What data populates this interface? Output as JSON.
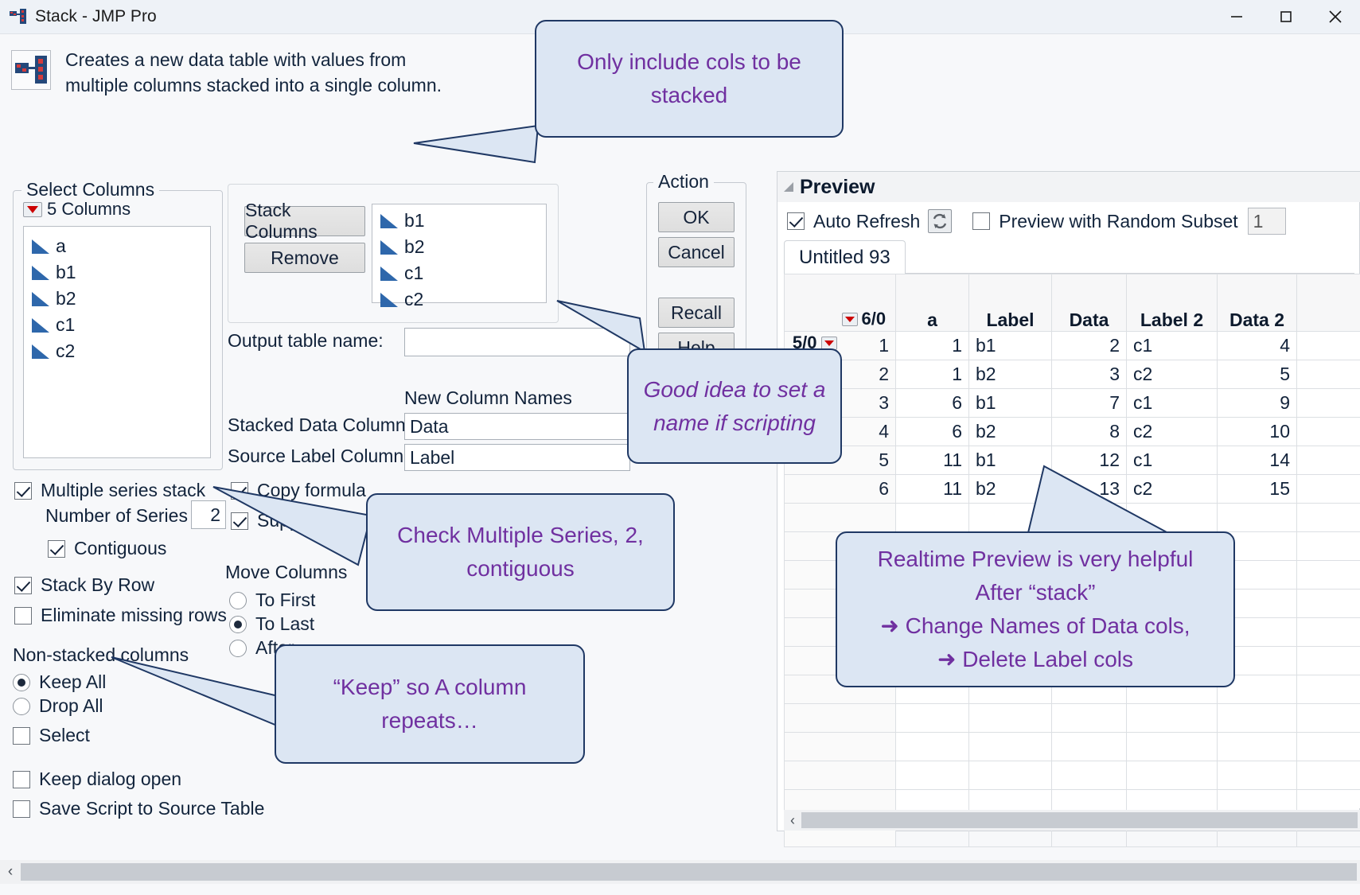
{
  "window": {
    "title": "Stack - JMP Pro",
    "minimize": "minimize-icon",
    "maximize": "maximize-icon",
    "close": "close-icon"
  },
  "description": "Creates a new data table with values from multiple columns stacked into a single column.",
  "select_columns": {
    "legend": "Select Columns",
    "count_label": "5 Columns",
    "items": [
      "a",
      "b1",
      "b2",
      "c1",
      "c2"
    ]
  },
  "stack_box": {
    "stack_button": "Stack Columns",
    "remove_button": "Remove",
    "items": [
      "b1",
      "b2",
      "c1",
      "c2"
    ]
  },
  "output_table": {
    "label": "Output table name:",
    "value": "",
    "placeholder": ""
  },
  "new_column_names": {
    "heading": "New Column Names",
    "stacked_data_label": "Stacked Data Column",
    "stacked_data_value": "Data",
    "source_label_label": "Source Label Column",
    "source_label_value": "Label"
  },
  "options": {
    "multiple_series_stack": {
      "label": "Multiple series stack",
      "checked": true
    },
    "number_of_series": {
      "label": "Number of Series",
      "value": "2"
    },
    "contiguous": {
      "label": "Contiguous",
      "checked": true
    },
    "stack_by_row": {
      "label": "Stack By Row",
      "checked": true
    },
    "eliminate_missing_rows": {
      "label": "Eliminate missing rows",
      "checked": false
    },
    "copy_formula": {
      "label": "Copy formula",
      "checked": true
    },
    "suppress_formula_evaluation": {
      "label": "Suppress formula evaluation",
      "checked": true
    },
    "non_stacked_columns": {
      "heading": "Non-stacked columns",
      "keep_all": {
        "label": "Keep All",
        "selected": true
      },
      "drop_all": {
        "label": "Drop All",
        "selected": false
      },
      "select": {
        "label": "Select",
        "checked": false
      }
    },
    "move_columns": {
      "heading": "Move Columns",
      "to_first": {
        "label": "To First",
        "selected": false
      },
      "to_last": {
        "label": "To Last",
        "selected": true
      },
      "after": {
        "label": "After",
        "selected": false
      }
    },
    "keep_dialog_open": {
      "label": "Keep dialog open",
      "checked": false
    },
    "save_script_to_source_table": {
      "label": "Save Script to Source Table",
      "checked": false
    }
  },
  "action": {
    "legend": "Action",
    "ok": "OK",
    "cancel": "Cancel",
    "recall": "Recall",
    "help": "Help"
  },
  "preview": {
    "title": "Preview",
    "auto_refresh": {
      "label": "Auto Refresh",
      "checked": true
    },
    "refresh_icon": "refresh-icon",
    "random_subset": {
      "label": "Preview with Random Subset",
      "checked": false,
      "value": "1"
    },
    "tab": "Untitled 93",
    "corner": {
      "columns": "5/0",
      "rows": "6/0"
    },
    "columns": [
      "a",
      "Label",
      "Data",
      "Label 2",
      "Data 2"
    ],
    "rows": [
      {
        "n": "1",
        "a": "1",
        "label": "b1",
        "data": "2",
        "label2": "c1",
        "data2": "4"
      },
      {
        "n": "2",
        "a": "1",
        "label": "b2",
        "data": "3",
        "label2": "c2",
        "data2": "5"
      },
      {
        "n": "3",
        "a": "6",
        "label": "b1",
        "data": "7",
        "label2": "c1",
        "data2": "9"
      },
      {
        "n": "4",
        "a": "6",
        "label": "b2",
        "data": "8",
        "label2": "c2",
        "data2": "10"
      },
      {
        "n": "5",
        "a": "11",
        "label": "b1",
        "data": "12",
        "label2": "c1",
        "data2": "14"
      },
      {
        "n": "6",
        "a": "11",
        "label": "b2",
        "data": "13",
        "label2": "c2",
        "data2": "15"
      }
    ]
  },
  "callouts": {
    "one": "Only include cols to be stacked",
    "two": "Good idea to set a name if scripting",
    "three": "Check Multiple Series, 2, contiguous",
    "four": "“Keep” so A column repeats…",
    "five_line1": "Realtime Preview is very helpful",
    "five_line2": "After “stack”",
    "five_line3": "➜ Change Names of Data cols,",
    "five_line4": "➜ Delete Label cols"
  },
  "colors": {
    "callout_text": "#7030a0",
    "callout_fill": "#dce6f3",
    "callout_border": "#1f3864",
    "column_icon": "#2e67ab",
    "red_triangle": "#cc0000"
  }
}
